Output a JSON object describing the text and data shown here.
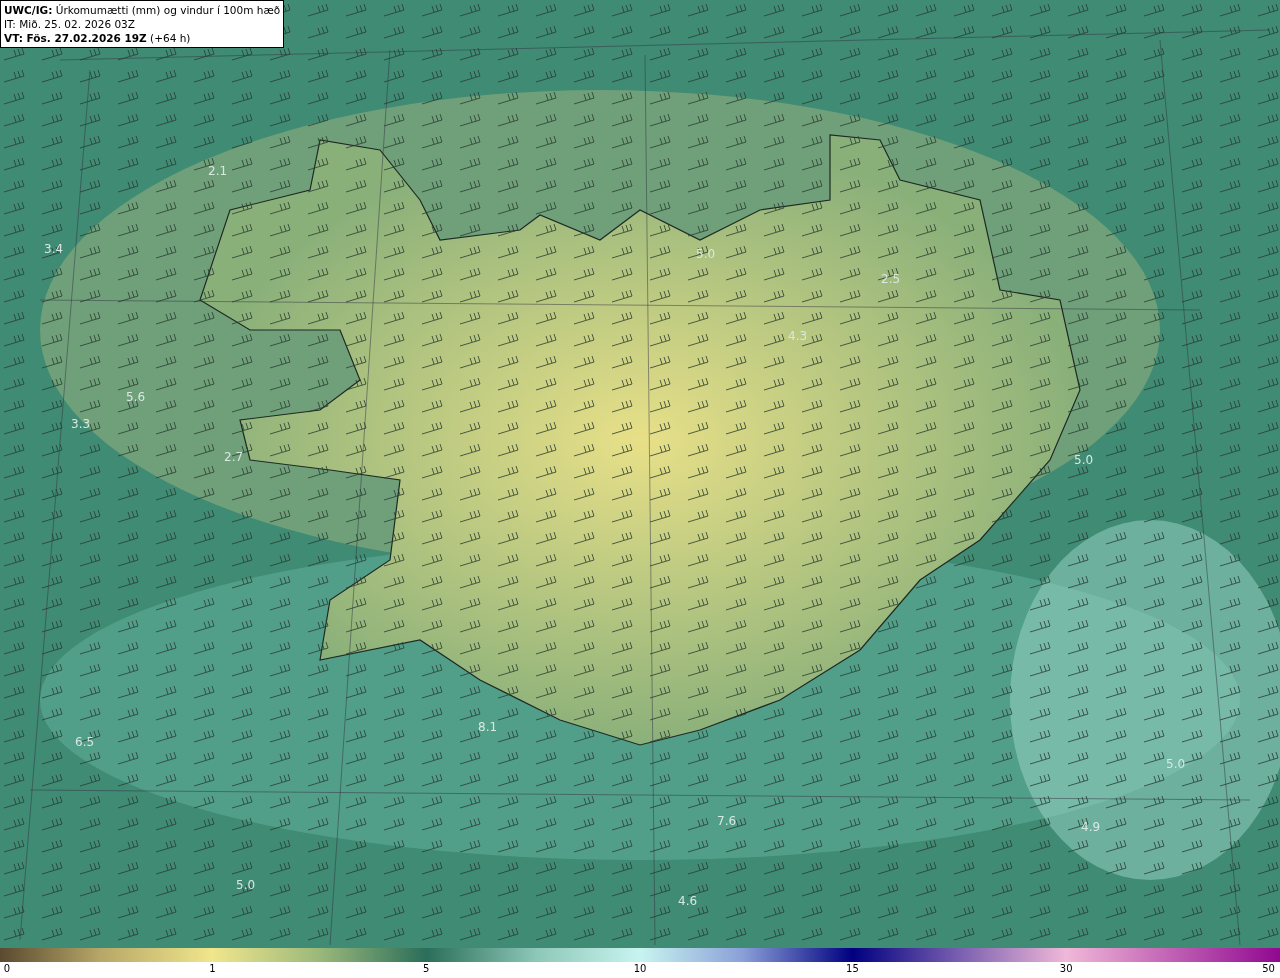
{
  "header": {
    "lines": [
      "**UWC/IG:** Úrkomumætti (mm) og vindur í 100m hæð",
      "IT: Mið. 25. 02. 2026 03Z",
      "**VT: Fös. 27.02.2026 19Z** (+64 h)"
    ]
  },
  "map": {
    "values": [
      "2.1",
      "3.4",
      "5.0",
      "2.5",
      "4.3",
      "5.6",
      "3.3",
      "2.7",
      "5.0",
      "8.1",
      "6.5",
      "5.0",
      "7.6",
      "4.9",
      "5.0",
      "4.6"
    ]
  },
  "colorbar": {
    "ticks": [
      "0",
      "1",
      "5",
      "10",
      "15",
      "30",
      "50"
    ]
  }
}
